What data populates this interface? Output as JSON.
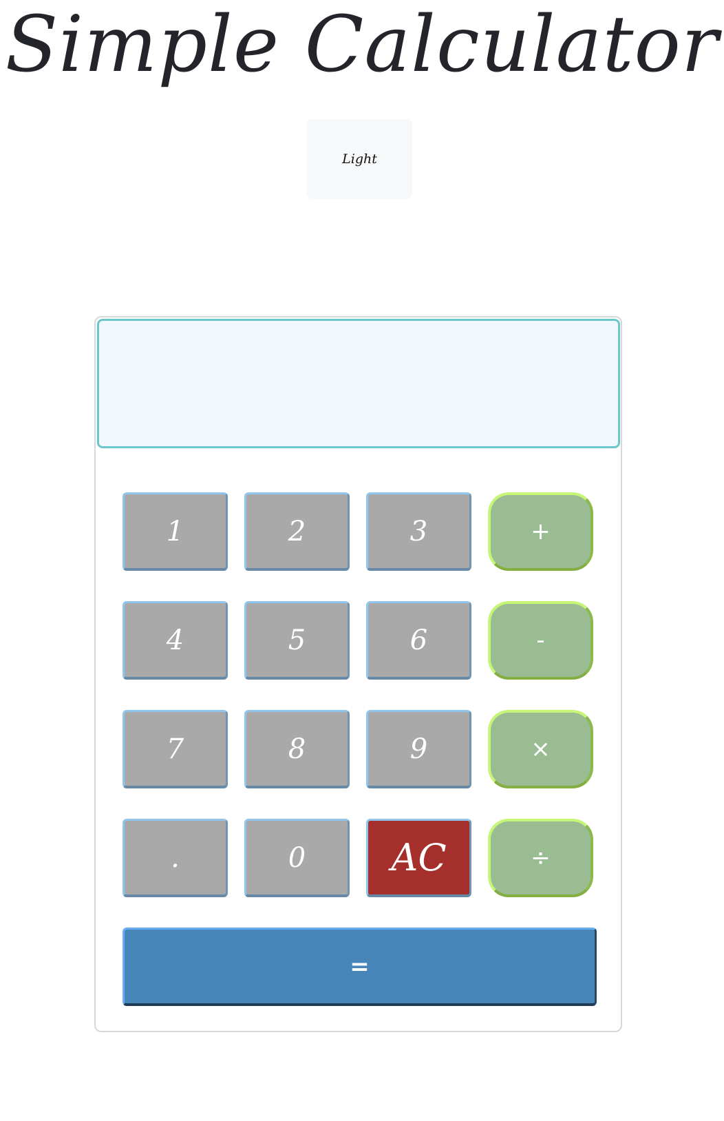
{
  "page": {
    "title": "Simple Calculator",
    "theme_toggle_label": "Light"
  },
  "calculator": {
    "display_value": "",
    "digit_keys": [
      "1",
      "2",
      "3",
      "4",
      "5",
      "6",
      "7",
      "8",
      "9",
      ".",
      "0"
    ],
    "operator_keys": {
      "add": "+",
      "subtract": "-",
      "multiply": "×",
      "divide": "÷"
    },
    "clear_label": "AC",
    "equals_label": "="
  },
  "colors": {
    "digit_button": "#a9a9a9",
    "operator_button": "#99bc93",
    "clear_button": "#a52f2a",
    "equals_button": "#4886ba",
    "display_background": "#f0f7fd",
    "display_border": "#6cc7cc"
  }
}
